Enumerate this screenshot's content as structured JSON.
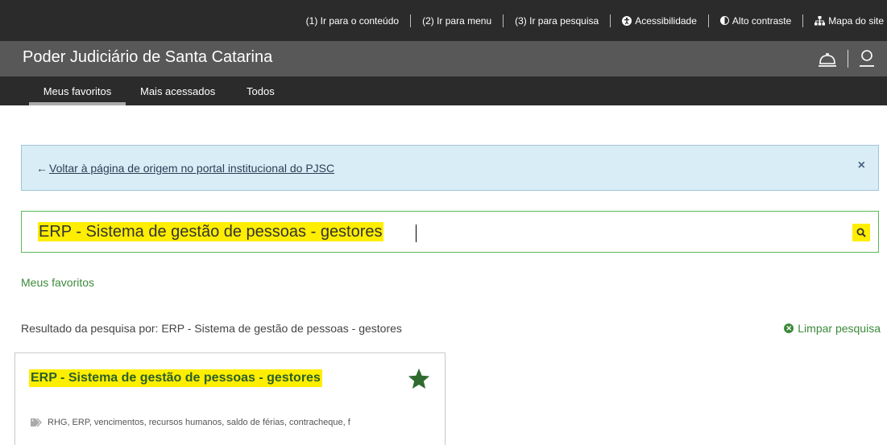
{
  "topbar": {
    "links": [
      {
        "label": "(1) Ir para o conteúdo"
      },
      {
        "label": "(2) Ir para menu"
      },
      {
        "label": "(3) Ir para pesquisa"
      },
      {
        "label": "Acessibilidade",
        "icon": "accessibility-icon"
      },
      {
        "label": "Alto contraste",
        "icon": "contrast-icon"
      },
      {
        "label": "Mapa do site",
        "icon": "sitemap-icon"
      }
    ]
  },
  "header": {
    "title": "Poder Judiciário de Santa Catarina",
    "icons": [
      "service-bell-icon",
      "user-icon"
    ]
  },
  "tabs": [
    {
      "label": "Meus favoritos",
      "active": true
    },
    {
      "label": "Mais acessados",
      "active": false
    },
    {
      "label": "Todos",
      "active": false
    }
  ],
  "notice": {
    "arrow": "←",
    "link_text": "Voltar à página de origem no portal institucional do PJSC",
    "close": "×"
  },
  "search": {
    "value": "ERP - Sistema de gestão de pessoas - gestores",
    "highlight_color": "#ffee00"
  },
  "breadcrumb": "Meus favoritos",
  "results": {
    "summary": "Resultado da pesquisa por: ERP - Sistema de gestão de pessoas - gestores",
    "clear_label": "Limpar pesquisa"
  },
  "card": {
    "title": "ERP - Sistema de gestão de pessoas - gestores",
    "favorited": true,
    "tags": "RHG, ERP, vencimentos, recursos humanos, saldo de férias, contracheque, f"
  },
  "colors": {
    "topbar": "#2b2b2b",
    "titlebar": "#585858",
    "accent_green": "#3c8a3c",
    "notice_bg": "#d9edf7",
    "highlight": "#ffee00"
  }
}
